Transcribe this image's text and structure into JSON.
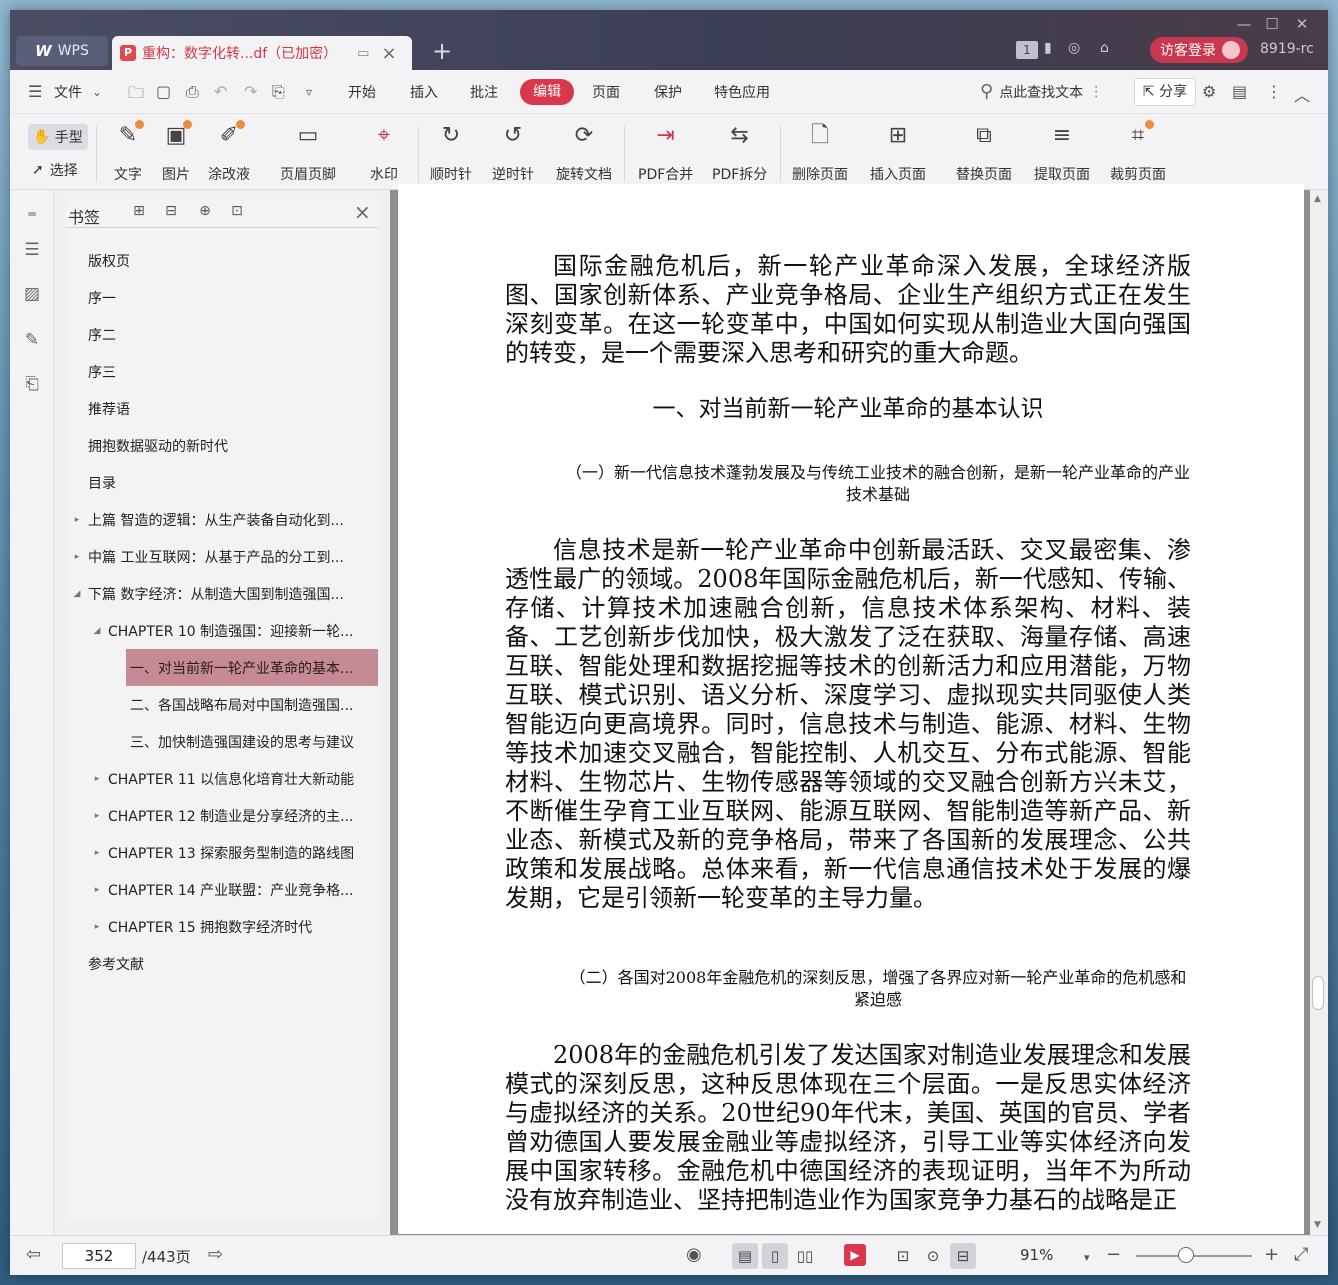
{
  "titlebar": {
    "app_tab": "WPS",
    "doc_tab_title": "重构：数字化转...df（已加密）",
    "page_badge": "1",
    "guest_login": "访客登录",
    "version": "8919-rc"
  },
  "menubar": {
    "file": "文件",
    "items": [
      "开始",
      "插入",
      "批注",
      "编辑",
      "页面",
      "保护",
      "特色应用"
    ],
    "active": "编辑",
    "search": "点此查找文本",
    "share": "分享"
  },
  "ribbon": {
    "hand": "手型",
    "select": "选择",
    "tools": [
      "文字",
      "图片",
      "涂改液",
      "页眉页脚",
      "水印",
      "顺时针",
      "逆时针",
      "旋转文档",
      "PDF合并",
      "PDF拆分",
      "删除页面",
      "插入页面",
      "替换页面",
      "提取页面",
      "裁剪页面"
    ]
  },
  "bookmarks": {
    "title": "书签",
    "items": [
      "版权页",
      "序一",
      "序二",
      "序三",
      "推荐语",
      "拥抱数据驱动的新时代",
      "目录",
      "上篇 智造的逻辑：从生产装备自动化到...",
      "中篇 工业互联网：从基于产品的分工到...",
      "下篇 数字经济：从制造大国到制造强国...",
      "CHAPTER 10 制造强国：迎接新一轮...",
      "一、对当前新一轮产业革命的基本...",
      "二、各国战略布局对中国制造强国...",
      "三、加快制造强国建设的思考与建议",
      "CHAPTER 11 以信息化培育壮大新动能",
      "CHAPTER 12 制造业是分享经济的主...",
      "CHAPTER 13 探索服务型制造的路线图",
      "CHAPTER 14 产业联盟：产业竞争格...",
      "CHAPTER 15 拥抱数字经济时代",
      "参考文献"
    ]
  },
  "document": {
    "para1": "国际金融危机后，新一轮产业革命深入发展，全球经济版图、国家创新体系、产业竞争格局、企业生产组织方式正在发生深刻变革。在这一轮变革中，中国如何实现从制造业大国向强国的转变，是一个需要深入思考和研究的重大命题。",
    "heading1": "一、对当前新一轮产业革命的基本认识",
    "sub1": "（一）新一代信息技术蓬勃发展及与传统工业技术的融合创新，是新一轮产业革命的产业技术基础",
    "para2": "信息技术是新一轮产业革命中创新最活跃、交叉最密集、渗透性最广的领域。2008年国际金融危机后，新一代感知、传输、存储、计算技术加速融合创新，信息技术体系架构、材料、装备、工艺创新步伐加快，极大激发了泛在获取、海量存储、高速互联、智能处理和数据挖掘等技术的创新活力和应用潜能，万物互联、模式识别、语义分析、深度学习、虚拟现实共同驱使人类智能迈向更高境界。同时，信息技术与制造、能源、材料、生物等技术加速交叉融合，智能控制、人机交互、分布式能源、智能材料、生物芯片、生物传感器等领域的交叉融合创新方兴未艾，不断催生孕育工业互联网、能源互联网、智能制造等新产品、新业态、新模式及新的竞争格局，带来了各国新的发展理念、公共政策和发展战略。总体来看，新一代信息通信技术处于发展的爆发期，它是引领新一轮变革的主导力量。",
    "sub2": "（二）各国对2008年金融危机的深刻反思，增强了各界应对新一轮产业革命的危机感和紧迫感",
    "para3": "2008年的金融危机引发了发达国家对制造业发展理念和发展模式的深刻反思，这种反思体现在三个层面。一是反思实体经济与虚拟经济的关系。20世纪90年代末，美国、英国的官员、学者曾劝德国人要发展金融业等虚拟经济，引导工业等实体经济向发展中国家转移。金融危机中德国经济的表现证明，当年不为所动没有放弃制造业、坚持把制造业作为国家竞争力基石的战略是正"
  },
  "statusbar": {
    "current_page": "352",
    "total_pages": "/443页",
    "zoom": "91%"
  },
  "colors": {
    "accent": "#d9374c",
    "active_bookmark": "#c48b94",
    "titlebar": "#3c3f56"
  }
}
